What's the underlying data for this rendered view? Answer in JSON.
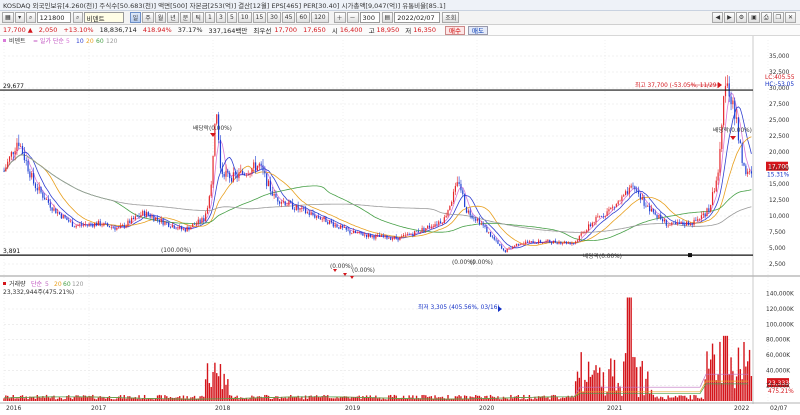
{
  "info_bar": {
    "text": "KOSDAQ 외국인보유[4.260(천)] 주식수[50.683(천)] 액면[500] 자본금[253(억)] 결산[12월] EPS[465] PER[30.40] 시가총액[9,047(억)] 유통비율[85.1]"
  },
  "toolbar": {
    "code": "121800",
    "name": "비덴트",
    "periods": [
      "일",
      "주",
      "월",
      "년",
      "분",
      "틱",
      "1",
      "3",
      "5",
      "10",
      "15",
      "30",
      "45",
      "60",
      "120"
    ],
    "count": "300",
    "count_unit": "300",
    "date": "2022/02/07",
    "search_label": "조회"
  },
  "price_bar": {
    "price": "17,700",
    "arrow": "▲",
    "change": "2,050",
    "change_pct": "+13.10%",
    "volume": "18,836,714",
    "amount": "418.94%",
    "ratio": "37.17%",
    "trade_value": "337,164백만",
    "best_ask_label": "최우선",
    "best_ask": "17,700",
    "best_bid": "17,650",
    "open_label": "시",
    "open": "16,400",
    "high_label": "고",
    "high": "18,950",
    "low_label": "저",
    "low": "16,350",
    "buy_label": "매수",
    "sell_label": "매도"
  },
  "chart": {
    "colors": {
      "up": "#e5262b",
      "down": "#1e3fd4",
      "ma5": "#d97ad9",
      "ma10": "#2f3fd0",
      "ma20": "#e8a020",
      "ma60": "#48a048",
      "ma120": "#9a9a9a",
      "volume": "#d4151b",
      "grid": "#e4e4e4"
    },
    "price_legend": {
      "name": "비덴트",
      "ma_label": "= 일가 단순",
      "periods": [
        "5",
        "10",
        "20",
        "60",
        "120"
      ]
    },
    "volume_legend": {
      "name": "거래량",
      "ma_label": "단순",
      "periods": [
        "5",
        "20",
        "60",
        "120"
      ],
      "value": "23,332,944주(475.21%)"
    },
    "levels": {
      "upper": "29,677",
      "lower": "3,891"
    },
    "badges": {
      "lc": "LC:405.55",
      "hc": "HC:-53.05"
    },
    "current_price": "17,700",
    "pct_label": "15.31%",
    "annotations": {
      "high_note": "최고 37,700 (-53.05%, 11/29)",
      "low_note": "최저 3,305 (405.56%, 03/16)",
      "dividend_1": "배당락(0.00%)",
      "dividend_2": "배당락(0.00%)",
      "dividend_3": "배당락(0.00%)",
      "dividend_4": "(0.00%)",
      "dividend_5": "(0.00%)",
      "pct_1": "(100.00%)",
      "pct_2": "(0.00%)",
      "pct_3": "(0.00%)"
    },
    "price_axis": [
      "35,000",
      "32,500",
      "30,000",
      "27,500",
      "25,000",
      "22,500",
      "20,000",
      "17,500",
      "15,000",
      "12,500",
      "10,000",
      "7,500",
      "5,000",
      "2,500"
    ],
    "volume_axis": [
      "140,000K",
      "120,000K",
      "100,000K",
      "80,000K",
      "60,000K",
      "40,000K",
      "20,000K"
    ],
    "volume_current": "23,333K",
    "volume_pct": "475.21%",
    "x_labels": [
      "2016",
      "2017",
      "2018",
      "2019",
      "2020",
      "2021",
      "2022",
      "02/07"
    ]
  }
}
